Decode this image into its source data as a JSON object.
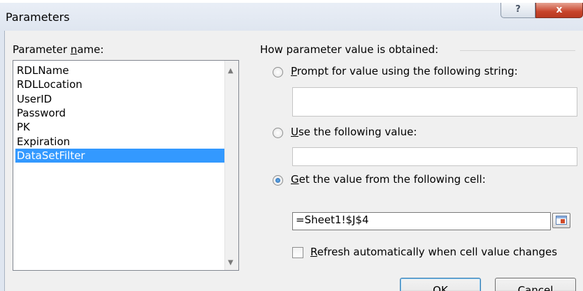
{
  "window": {
    "title": "Parameters",
    "help_label": "?",
    "close_label": "x"
  },
  "parameter_list": {
    "label": "Parameter name:",
    "items": [
      "RDLName",
      "RDLLocation",
      "UserID",
      "Password",
      "PK",
      "Expiration",
      "DataSetFilter"
    ],
    "selected": "DataSetFilter"
  },
  "value_source": {
    "group_label": "How parameter value is obtained:",
    "prompt_option": {
      "label": "Prompt for value using the following string:",
      "value": ""
    },
    "fixed_value_option": {
      "label": "Use the following value:",
      "value": ""
    },
    "cell_option": {
      "label": "Get the value from the following cell:",
      "value": "=Sheet1!$J$4"
    },
    "selected_option": "cell_option",
    "refresh_checkbox": {
      "label": "Refresh automatically when cell value changes",
      "checked": false
    }
  },
  "buttons": {
    "ok_label": "OK",
    "cancel_label": "Cancel"
  },
  "icons": {
    "cell_reference": "cell-reference-icon",
    "scroll_up": "scroll-up-arrow-icon",
    "scroll_down": "scroll-down-arrow-icon"
  },
  "colors": {
    "selection": "#3399ff",
    "close_button": "#c8452c",
    "dialog_background": "#f0f0f0"
  }
}
